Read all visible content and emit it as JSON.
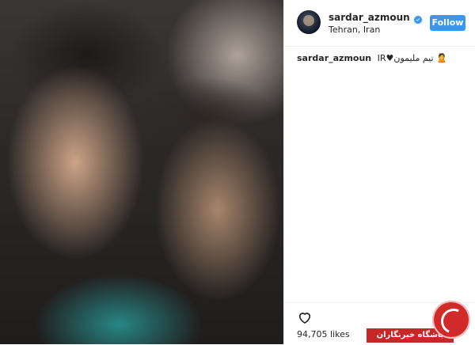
{
  "post": {
    "username": "sardar_azmoun",
    "location": "Tehran, Iran",
    "follow_label": "Follow",
    "caption_user": "sardar_azmoun",
    "caption_text": "IR♥تیم ملیمون 🙎",
    "likes_text": "94,705 likes"
  },
  "icons": {
    "verified": "verified-badge-icon",
    "heart": "heart-outline-icon"
  },
  "colors": {
    "follow_button": "#3897f0",
    "watermark_red": "#c62828"
  },
  "watermark": {
    "text": "باشگاه خبرنگاران"
  }
}
